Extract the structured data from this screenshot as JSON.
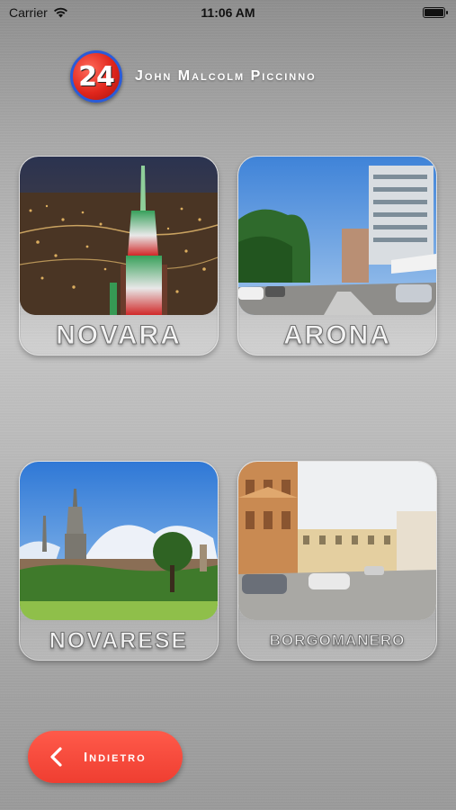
{
  "status_bar": {
    "carrier": "Carrier",
    "time": "11:06 AM",
    "wifi_icon": "wifi-icon",
    "battery_icon": "battery-icon"
  },
  "header": {
    "logo_text": "24",
    "title": "John Malcolm Piccinno"
  },
  "cities": [
    {
      "label": "NOVARA",
      "photo": "novara-night-photo"
    },
    {
      "label": "ARONA",
      "photo": "arona-street-photo"
    },
    {
      "label": "NOVARESE",
      "photo": "novarese-landscape-photo"
    },
    {
      "label": "BORGOMANERO",
      "photo": "borgomanero-square-photo"
    }
  ],
  "back_button": {
    "label": "Indietro",
    "icon": "chevron-left-icon"
  },
  "colors": {
    "accent": "#ef3e31",
    "logo_ring": "#2a5bd8"
  }
}
